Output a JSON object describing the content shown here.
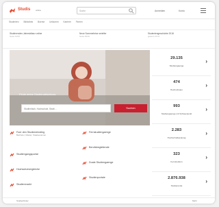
{
  "colors": {
    "brand_red": "#e8492f",
    "button_red": "#c8202f"
  },
  "header": {
    "logo_text": "Studis",
    "logo_sub": "online",
    "search_placeholder": "Suche",
    "login": "Anmelden",
    "user": "Konto"
  },
  "nav_items": [
    "Studenten",
    "Bibliothek",
    "Boerse",
    "Unikomm",
    "Karriere",
    "Firmen"
  ],
  "news": [
    {
      "title": "Studierenden-Jahresbilanz online",
      "meta": "heute 14:03"
    },
    {
      "title": "Neue Sommerbrise serieller",
      "meta": "heute 09:40"
    },
    {
      "title": "Studentengeschichte 2018",
      "meta": "gestern 21:12"
    }
  ],
  "hero": {
    "label": "Finde deine Studienabschluss",
    "search_placeholder": "Studienfach, Hochschule, Stadt ...",
    "button_label": "Suchen"
  },
  "stats": [
    {
      "value": "29.135",
      "label": "Studiengaenge"
    },
    {
      "value": "474",
      "label": "Hochschulen"
    },
    {
      "value": "993",
      "label": "Studiengaenge mit Schwerpunkt"
    },
    {
      "value": "2.283",
      "label": "Hochschulberatung"
    },
    {
      "value": "323",
      "label": "Fernstudium"
    },
    {
      "value": "2.876.938",
      "label": "Studierende"
    }
  ],
  "links": [
    {
      "label": "Fuer den Studieneinstieg",
      "sub": "Bachelor, Master, Staatsexamen"
    },
    {
      "label": "Studiengangsportal"
    },
    {
      "label": "Hochschulvergleiche"
    },
    {
      "label": "Studienmarkt"
    },
    {
      "label": "Fernstudiengaenge"
    },
    {
      "label": "Berufsbegleitende"
    },
    {
      "label": "Duale Studiengaenge"
    },
    {
      "label": "Studienportale"
    }
  ],
  "footer": {
    "left": "Studienfinder",
    "right": "Mehr"
  }
}
